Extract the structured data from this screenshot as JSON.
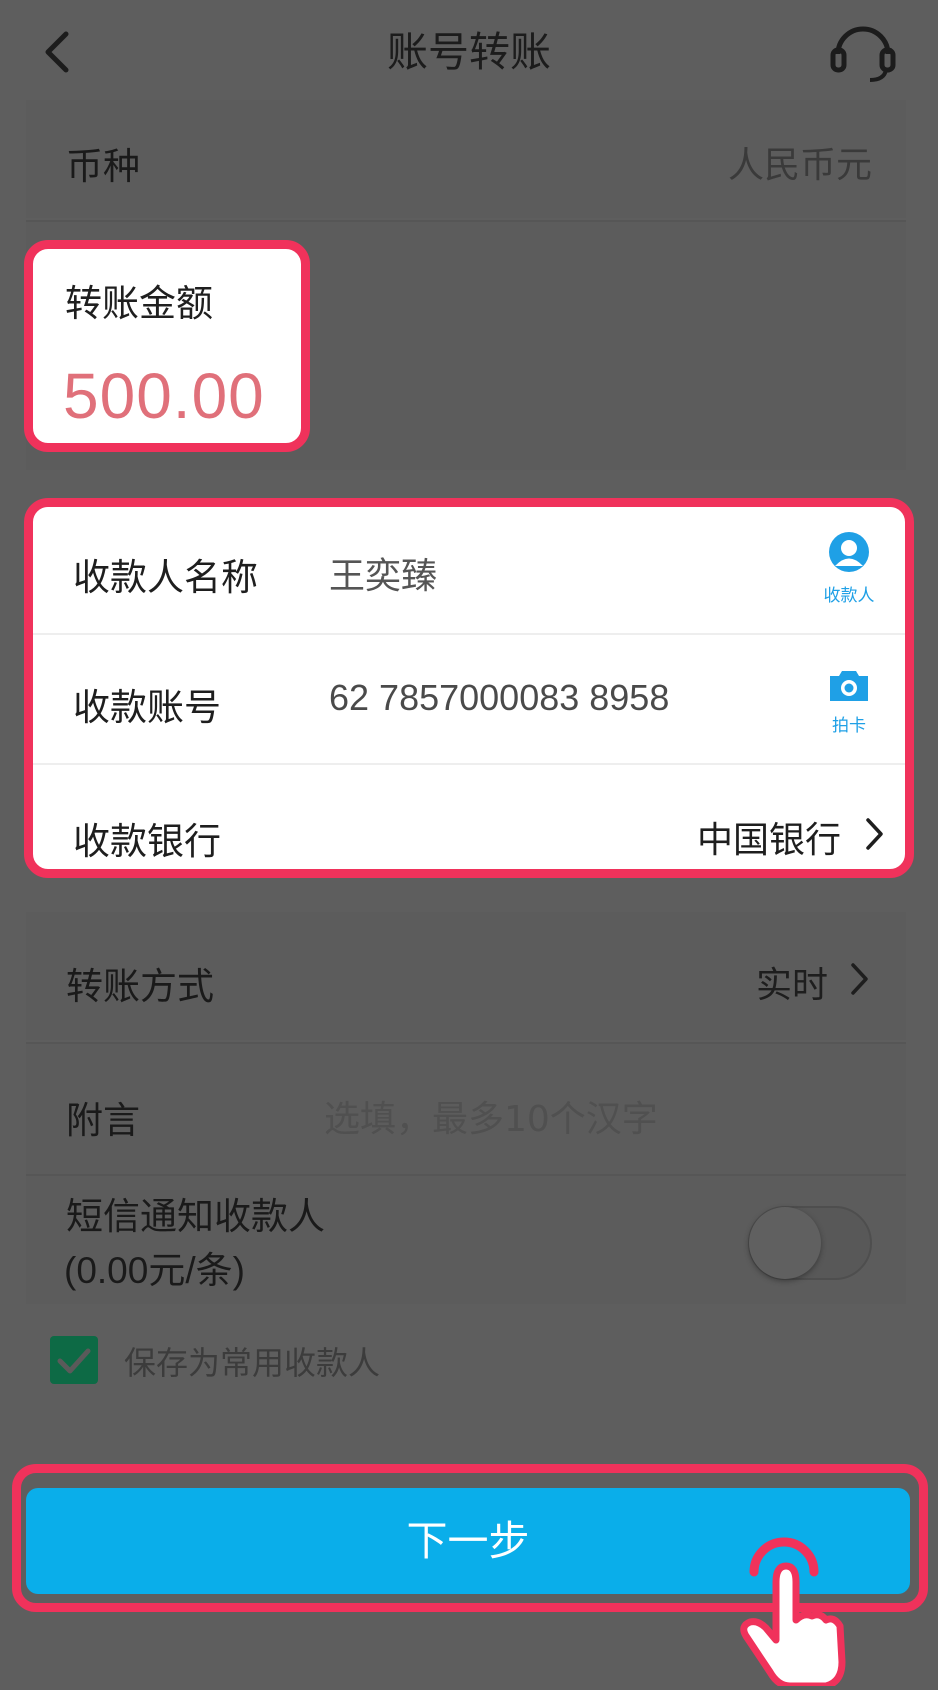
{
  "header": {
    "title": "账号转账"
  },
  "currency": {
    "label": "币种",
    "value": "人民币元"
  },
  "amount": {
    "label": "转账金额",
    "value": "500.00"
  },
  "payee": {
    "name_label": "收款人名称",
    "name_value": "王奕臻",
    "name_icon_label": "收款人",
    "account_label": "收款账号",
    "account_value": "62 7857000083 8958",
    "account_icon_label": "拍卡",
    "bank_label": "收款银行",
    "bank_value": "中国银行"
  },
  "method": {
    "label": "转账方式",
    "value": "实时"
  },
  "memo": {
    "label": "附言",
    "placeholder": "选填，最多10个汉字"
  },
  "sms": {
    "label_line1": "短信通知收款人",
    "label_line2": "(0.00元/条)",
    "enabled": false
  },
  "save_payee": {
    "label": "保存为常用收款人",
    "checked": true
  },
  "next_button": {
    "label": "下一步"
  },
  "colors": {
    "accent": "#0aaeea",
    "highlight": "#f0325b",
    "amount": "#e0707a",
    "icon": "#1fa0e6"
  }
}
